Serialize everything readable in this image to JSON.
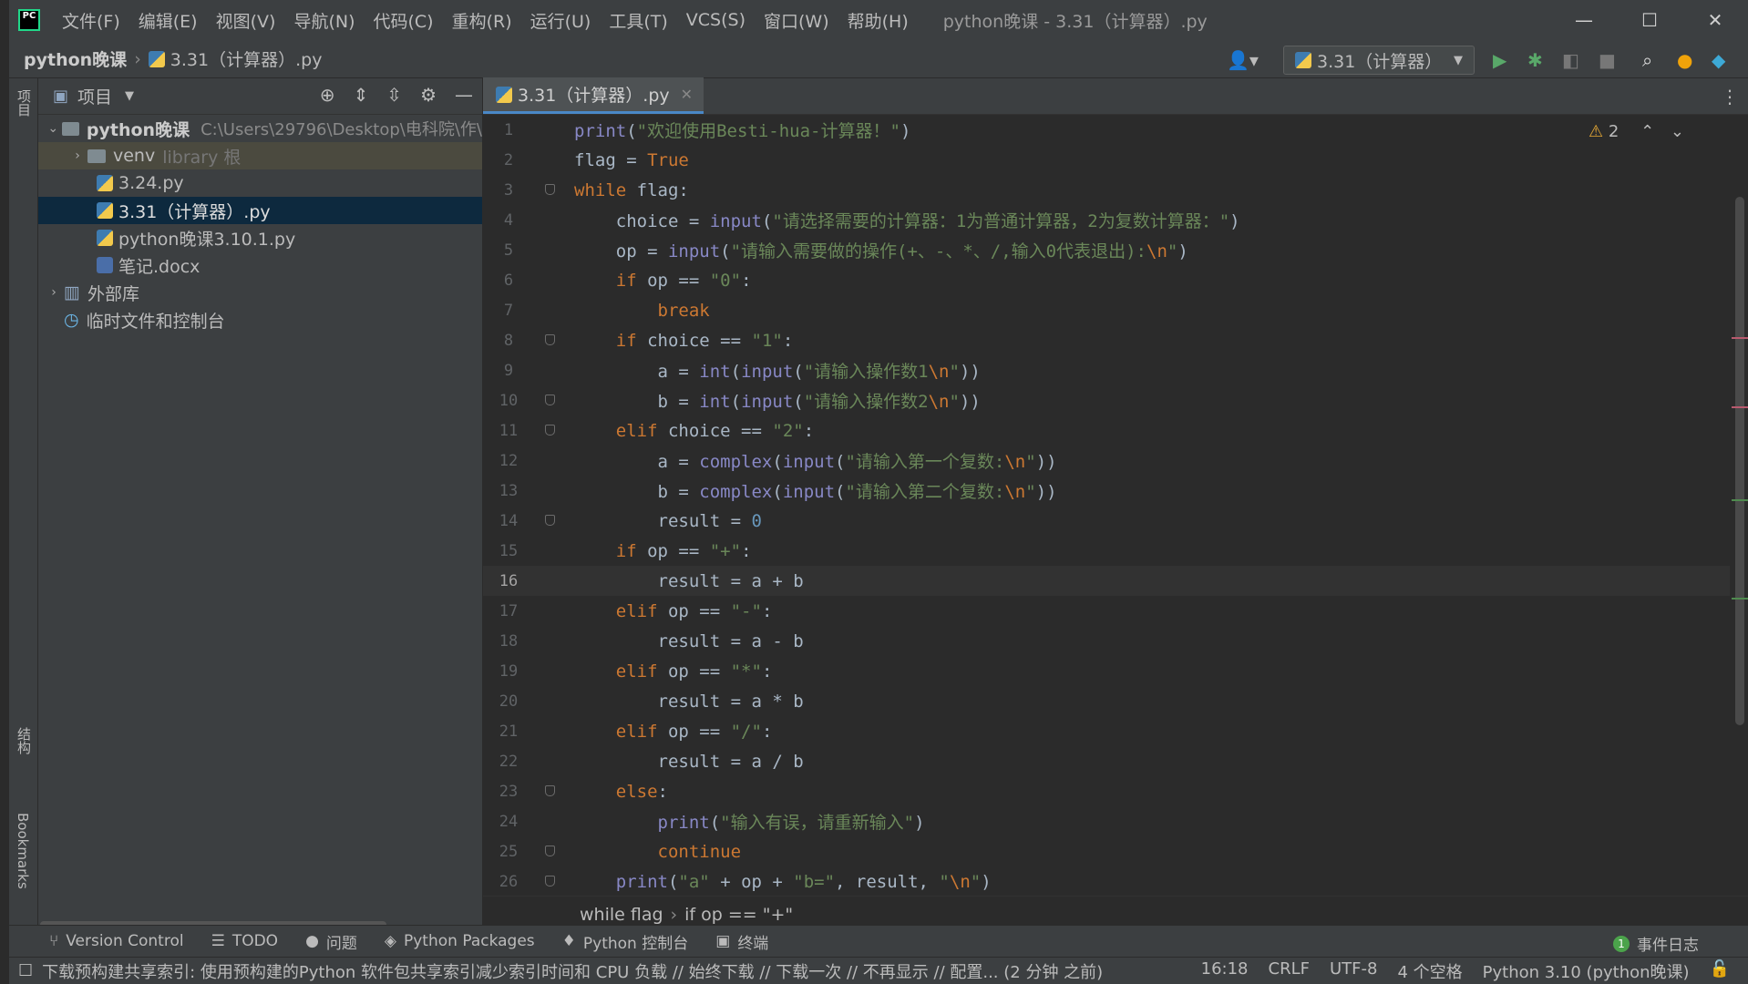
{
  "titlebar": {
    "logo_text": "PC",
    "menus": [
      "文件(F)",
      "编辑(E)",
      "视图(V)",
      "导航(N)",
      "代码(C)",
      "重构(R)",
      "运行(U)",
      "工具(T)",
      "VCS(S)",
      "窗口(W)",
      "帮助(H)"
    ],
    "window_title": "python晚课 - 3.31（计算器）.py"
  },
  "navbar": {
    "project": "python晚课",
    "file": "3.31（计算器）.py",
    "run_config": "3.31（计算器）"
  },
  "leftstrip": {
    "top": "项目",
    "mid": "结构",
    "bottom": "Bookmarks"
  },
  "project_panel": {
    "title": "项目",
    "root": {
      "name": "python晚课",
      "path": "C:\\Users\\29796\\Desktop\\电科院\\作\\"
    },
    "items": [
      {
        "name": "venv",
        "suffix": "library 根"
      },
      {
        "name": "3.24.py"
      },
      {
        "name": "3.31（计算器）.py"
      },
      {
        "name": "python晚课3.10.1.py"
      },
      {
        "name": "笔记.docx"
      }
    ],
    "external": "外部库",
    "scratch": "临时文件和控制台"
  },
  "editor": {
    "tab_label": "3.31（计算器）.py",
    "warnings": "2",
    "line_numbers": [
      "1",
      "2",
      "3",
      "4",
      "5",
      "6",
      "7",
      "8",
      "9",
      "10",
      "11",
      "12",
      "13",
      "14",
      "15",
      "16",
      "17",
      "18",
      "19",
      "20",
      "21",
      "22",
      "23",
      "24",
      "25",
      "26"
    ],
    "breadcrumb": [
      "while flag",
      "if op == \"+\""
    ]
  },
  "toolwindows": [
    "Version Control",
    "TODO",
    "问题",
    "Python Packages",
    "Python 控制台",
    "终端"
  ],
  "event_log": {
    "label": "事件日志",
    "count": "1"
  },
  "status": {
    "message": "下载预构建共享索引: 使用预构建的Python 软件包共享索引减少索引时间和 CPU 负载 // 始终下载 // 下载一次 // 不再显示 // 配置... (2 分钟 之前)",
    "position": "16:18",
    "line_sep": "CRLF",
    "encoding": "UTF-8",
    "indent": "4 个空格",
    "interpreter": "Python 3.10 (python晚课)"
  }
}
